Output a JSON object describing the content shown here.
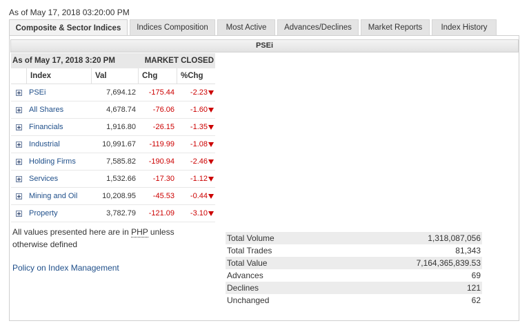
{
  "asof_top": "As of May 17, 2018 03:20:00 PM",
  "tabs": [
    {
      "label": "Composite & Sector Indices",
      "active": true
    },
    {
      "label": "Indices Composition",
      "active": false
    },
    {
      "label": "Most Active",
      "active": false
    },
    {
      "label": "Advances/Declines",
      "active": false
    },
    {
      "label": "Market Reports",
      "active": false
    },
    {
      "label": "Index History",
      "active": false
    }
  ],
  "panel_title": "PSEi",
  "table": {
    "asof": "As of May 17, 2018 3:20 PM",
    "market_status": "MARKET CLOSED",
    "headers": {
      "index": "Index",
      "val": "Val",
      "chg": "Chg",
      "pct": "%Chg"
    },
    "rows": [
      {
        "name": "PSEi",
        "val": "7,694.12",
        "chg": "-175.44",
        "pct": "-2.23"
      },
      {
        "name": "All Shares",
        "val": "4,678.74",
        "chg": "-76.06",
        "pct": "-1.60"
      },
      {
        "name": "Financials",
        "val": "1,916.80",
        "chg": "-26.15",
        "pct": "-1.35"
      },
      {
        "name": "Industrial",
        "val": "10,991.67",
        "chg": "-119.99",
        "pct": "-1.08"
      },
      {
        "name": "Holding Firms",
        "val": "7,585.82",
        "chg": "-190.94",
        "pct": "-2.46"
      },
      {
        "name": "Services",
        "val": "1,532.66",
        "chg": "-17.30",
        "pct": "-1.12"
      },
      {
        "name": "Mining and Oil",
        "val": "10,208.95",
        "chg": "-45.53",
        "pct": "-0.44"
      },
      {
        "name": "Property",
        "val": "3,782.79",
        "chg": "-121.09",
        "pct": "-3.10"
      }
    ]
  },
  "note": {
    "before": "All values presented here are in ",
    "currency": "PHP",
    "after": " unless otherwise defined"
  },
  "policy_link": "Policy on Index Management",
  "stats": [
    {
      "label": "Total Volume",
      "value": "1,318,087,056"
    },
    {
      "label": "Total Trades",
      "value": "81,343"
    },
    {
      "label": "Total Value",
      "value": "7,164,365,839.53"
    },
    {
      "label": "Advances",
      "value": "69"
    },
    {
      "label": "Declines",
      "value": "121"
    },
    {
      "label": "Unchanged",
      "value": "62"
    }
  ],
  "colors": {
    "negative": "#cc0000",
    "link": "#1f4f8a"
  },
  "icons": {
    "expand": "plus-box-icon",
    "down": "down-arrow-icon"
  }
}
